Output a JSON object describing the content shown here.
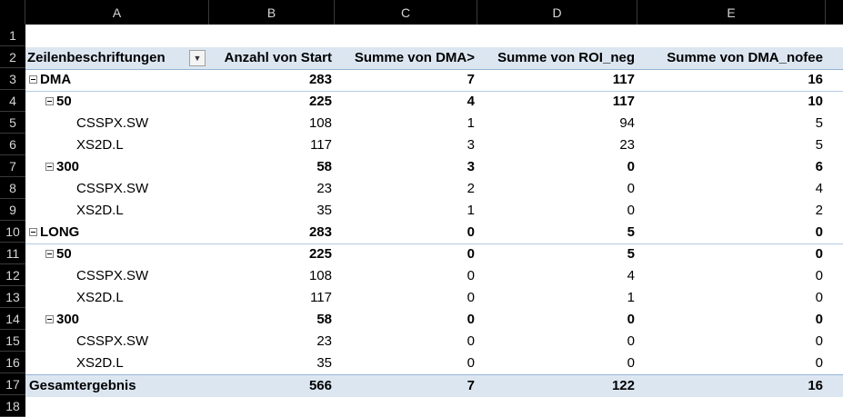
{
  "columns": [
    "A",
    "B",
    "C",
    "D",
    "E"
  ],
  "row_numbers": [
    "1",
    "2",
    "3",
    "4",
    "5",
    "6",
    "7",
    "8",
    "9",
    "10",
    "11",
    "12",
    "13",
    "14",
    "15",
    "16",
    "17",
    "18"
  ],
  "header": {
    "labels": "Zeilenbeschriftungen",
    "start": "Anzahl von Start",
    "dma_gt": "Summe von DMA>",
    "roi_neg": "Summe von ROI_neg",
    "dma_nofee": "Summe von DMA_nofee"
  },
  "filter_icon": "dropdown-filter-icon",
  "rows": [
    {
      "label": "DMA",
      "level": 0,
      "bold": true,
      "toggle": true,
      "values": [
        "283",
        "7",
        "117",
        "16"
      ]
    },
    {
      "label": "50",
      "level": 1,
      "bold": true,
      "toggle": true,
      "values": [
        "225",
        "4",
        "117",
        "10"
      ]
    },
    {
      "label": "CSSPX.SW",
      "level": 2,
      "bold": false,
      "toggle": false,
      "values": [
        "108",
        "1",
        "94",
        "5"
      ]
    },
    {
      "label": "XS2D.L",
      "level": 2,
      "bold": false,
      "toggle": false,
      "values": [
        "117",
        "3",
        "23",
        "5"
      ]
    },
    {
      "label": "300",
      "level": 1,
      "bold": true,
      "toggle": true,
      "values": [
        "58",
        "3",
        "0",
        "6"
      ]
    },
    {
      "label": "CSSPX.SW",
      "level": 2,
      "bold": false,
      "toggle": false,
      "values": [
        "23",
        "2",
        "0",
        "4"
      ]
    },
    {
      "label": "XS2D.L",
      "level": 2,
      "bold": false,
      "toggle": false,
      "values": [
        "35",
        "1",
        "0",
        "2"
      ]
    },
    {
      "label": "LONG",
      "level": 0,
      "bold": true,
      "toggle": true,
      "values": [
        "283",
        "0",
        "5",
        "0"
      ]
    },
    {
      "label": "50",
      "level": 1,
      "bold": true,
      "toggle": true,
      "values": [
        "225",
        "0",
        "5",
        "0"
      ]
    },
    {
      "label": "CSSPX.SW",
      "level": 2,
      "bold": false,
      "toggle": false,
      "values": [
        "108",
        "0",
        "4",
        "0"
      ]
    },
    {
      "label": "XS2D.L",
      "level": 2,
      "bold": false,
      "toggle": false,
      "values": [
        "117",
        "0",
        "1",
        "0"
      ]
    },
    {
      "label": "300",
      "level": 1,
      "bold": true,
      "toggle": true,
      "values": [
        "58",
        "0",
        "0",
        "0"
      ]
    },
    {
      "label": "CSSPX.SW",
      "level": 2,
      "bold": false,
      "toggle": false,
      "values": [
        "23",
        "0",
        "0",
        "0"
      ]
    },
    {
      "label": "XS2D.L",
      "level": 2,
      "bold": false,
      "toggle": false,
      "values": [
        "35",
        "0",
        "0",
        "0"
      ]
    }
  ],
  "total": {
    "label": "Gesamtergebnis",
    "values": [
      "566",
      "7",
      "122",
      "16"
    ]
  }
}
